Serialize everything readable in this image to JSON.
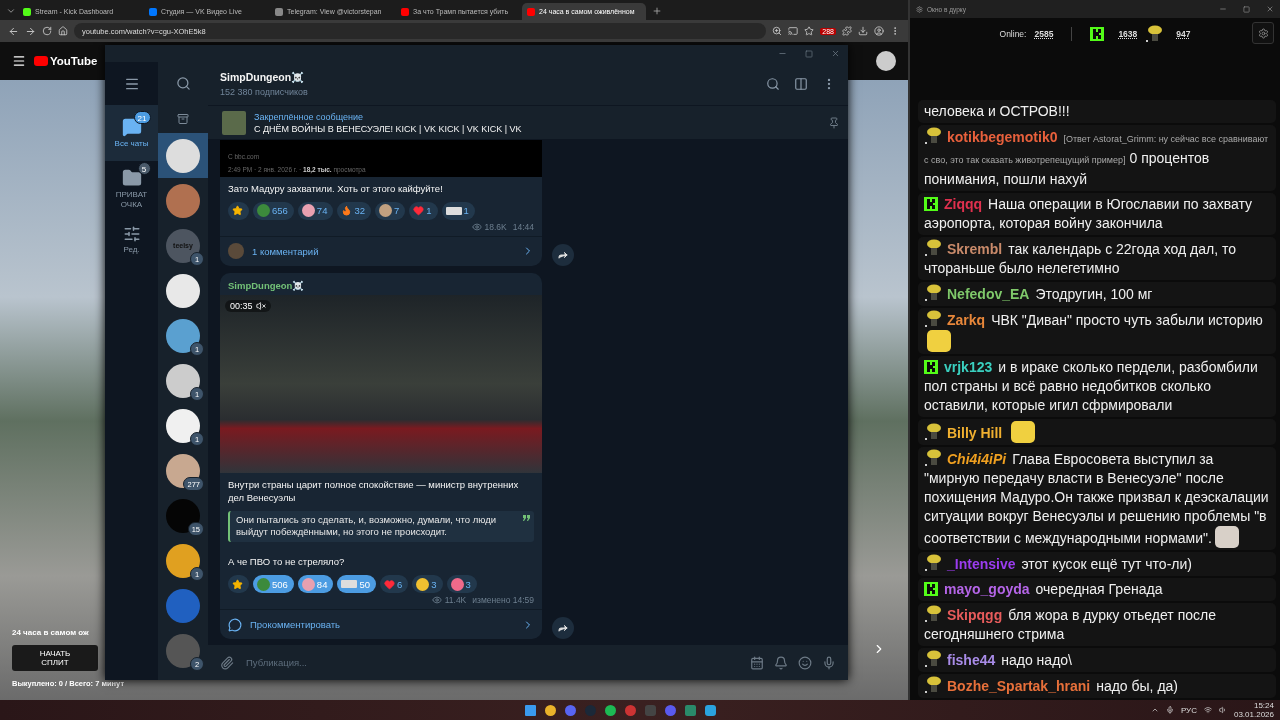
{
  "browser": {
    "tabs": [
      {
        "title": "Stream - Kick Dashboard",
        "kind": "kick",
        "selected": false
      },
      {
        "title": "Студия — VK Видео Live",
        "kind": "vk",
        "selected": false
      },
      {
        "title": "Telegram: View @victorstepan",
        "kind": "web",
        "selected": false
      },
      {
        "title": "За что Трамп пытается убить",
        "kind": "youtube",
        "selected": false
      },
      {
        "title": "24 часа в самом оживлённом",
        "kind": "youtube",
        "selected": true
      }
    ],
    "address": "youtube.com/watch?v=cgu-XOhE5k8",
    "extension_badge": "288"
  },
  "youtube": {
    "logo": "YouTube",
    "overlay": {
      "title": "24 часа в самом ож",
      "button": "НАЧАТЬ СПЛИТ",
      "footer": "Выкуплено: 0 / Всего: 7 минут"
    }
  },
  "telegram": {
    "folders": [
      {
        "label": "Все чаты",
        "badge": "21",
        "kind": "chats",
        "selected": true
      },
      {
        "label": "ПРИВАТ ОЧКА",
        "badge": "5",
        "kind": "folder",
        "selected": false
      },
      {
        "label": "Ред.",
        "kind": "edit",
        "selected": false
      }
    ],
    "chats": [
      {
        "selected": true
      },
      {
        "selected": false
      },
      {
        "avatar_text": "teelsy",
        "badge": "1",
        "selected": false
      },
      {
        "selected": false
      },
      {
        "badge": "1",
        "selected": false
      },
      {
        "badge": "1",
        "selected": false
      },
      {
        "badge": "1",
        "selected": false
      },
      {
        "badge": "277",
        "selected": false
      },
      {
        "badge": "15",
        "selected": false
      },
      {
        "badge": "1",
        "selected": false
      },
      {
        "selected": false
      },
      {
        "badge": "2",
        "selected": false
      }
    ],
    "channel": {
      "title": "SimpDungeon☠️",
      "subtitle": "152 380 подписчиков"
    },
    "pinned": {
      "label": "Закреплённое сообщение",
      "text": "С ДНЁМ ВОЙНЫ В ВЕНЕСУЭЛЕ!  KICK | VK KICK | VK KICK | VK"
    },
    "posts": [
      {
        "embed": {
          "source": "C bbc.com",
          "meta": "2:49 PM · 2 янв. 2026 г. · **18,2 тыс.** просмотра"
        },
        "blocks": [
          {
            "kind": "text",
            "text": "Зато Мадуру захватили. Хоть от этого кайфуйте!"
          }
        ],
        "reactions": [
          {
            "kind": "star",
            "selected": false
          },
          {
            "kind": "frog",
            "count": "656",
            "selected": false
          },
          {
            "kind": "clown",
            "count": "74",
            "selected": false
          },
          {
            "kind": "fire",
            "count": "32",
            "selected": false
          },
          {
            "kind": "bear",
            "count": "7",
            "selected": false
          },
          {
            "kind": "heart",
            "count": "1",
            "selected": false
          },
          {
            "kind": "sticker",
            "count": "1",
            "selected": false
          }
        ],
        "views": "18.6K",
        "time": "14:44",
        "comments": {
          "kind": "count",
          "label": "1 комментарий"
        }
      },
      {
        "author": "SimpDungeon☠️",
        "video": {
          "duration": "00:35",
          "muted": true
        },
        "blocks": [
          {
            "kind": "text",
            "text": "Внутри страны царит полное спокойствие — министр внутренних дел Венесуэлы"
          },
          {
            "kind": "quote",
            "text": "Они пытались это сделать, и, возможно, думали, что люди выйдут побеждёнными, но этого не происходит."
          },
          {
            "kind": "text",
            "text": "А че ПВО то не стреляло?"
          }
        ],
        "reactions": [
          {
            "kind": "star",
            "selected": false
          },
          {
            "kind": "frog",
            "count": "506",
            "selected": true
          },
          {
            "kind": "clown",
            "count": "84",
            "selected": true
          },
          {
            "kind": "sticker",
            "count": "50",
            "selected": true
          },
          {
            "kind": "heart",
            "count": "6",
            "selected": false
          },
          {
            "kind": "crying",
            "count": "3",
            "selected": false
          },
          {
            "kind": "pig",
            "count": "3",
            "selected": false
          }
        ],
        "views": "11.4K",
        "time": "изменено 14:59",
        "comments": {
          "kind": "write",
          "label": "Прокомментировать"
        }
      }
    ],
    "input": {
      "placeholder": "Публикация..."
    }
  },
  "chat": {
    "title": "Окно в дурку",
    "online_label": "Online:",
    "online": "2585",
    "kick_count": "1638",
    "other_count": "947",
    "messages": [
      {
        "text": "человека и ОСТРОВ!!!"
      },
      {
        "kind": "emote",
        "user": "kotikbegemotik0",
        "color": "#e8603c",
        "reply": "[Ответ Astorat_Grimm: ну сейчас все сравнивают с сво, это так сказать животрепещущий пример]",
        "text": "0 процентов понимания, пошли нахуй"
      },
      {
        "kind": "kick",
        "user": "Ziqqq",
        "color": "#e0304e",
        "text": "Наша операции в Югославии по захвату аэропорта, которая войну закончила"
      },
      {
        "kind": "emote",
        "user": "Skrembl",
        "color": "#c98a6a",
        "text": "так календарь с 22года ход дал, то чтораньше было нелегетимно"
      },
      {
        "kind": "emote",
        "user": "Nefedov_EA",
        "color": "#7fc86a",
        "text": "Этодругин, 100 мг"
      },
      {
        "kind": "emote",
        "user": "Zarkq",
        "color": "#e8873a",
        "text": "ЧВК \"Диван\" просто чуть забыли историю",
        "emote": true
      },
      {
        "kind": "kick",
        "user": "vrjk123",
        "color": "#3ad0c0",
        "text": "и в ираке сколько пердели, разбомбили пол страны и всё равно недобитков сколько оставили, которые игил сфрмировали"
      },
      {
        "kind": "emote",
        "user": "Billy Hill",
        "color": "#f0b030",
        "emote": true
      },
      {
        "kind": "emote",
        "user": "Chi4i4iPi",
        "color": "#f0a020",
        "italic": true,
        "text": "Глава Евросовета выступил за \"мирную передачу власти в Венесуэле\" после похищения Мадуро.Он также призвал к деэскалации ситуации вокруг Венесуэлы и решению проблемы \"в соответствии с международными нормами\".",
        "emote": true
      },
      {
        "kind": "emote",
        "user": "_Intensive",
        "color": "#9b3cf0",
        "text": "этот кусок ещё тут что-ли)"
      },
      {
        "kind": "kick",
        "user": "mayo_goyda",
        "color": "#b565e8",
        "text": "очередная Гренада"
      },
      {
        "kind": "emote",
        "user": "Skipqgg",
        "color": "#e85c5c",
        "text": "бля жора в дурку отьедет после сегодняшнего стрима"
      },
      {
        "kind": "emote",
        "user": "fishe44",
        "color": "#a98ce8",
        "text": "надо надо\\"
      },
      {
        "kind": "emote",
        "user": "Bozhe_Spartak_hrani",
        "color": "#e8703a",
        "text": "надо бы, да)"
      }
    ]
  },
  "taskbar": {
    "language": "РУС",
    "time": "15:24",
    "date": "03.01.2026"
  }
}
